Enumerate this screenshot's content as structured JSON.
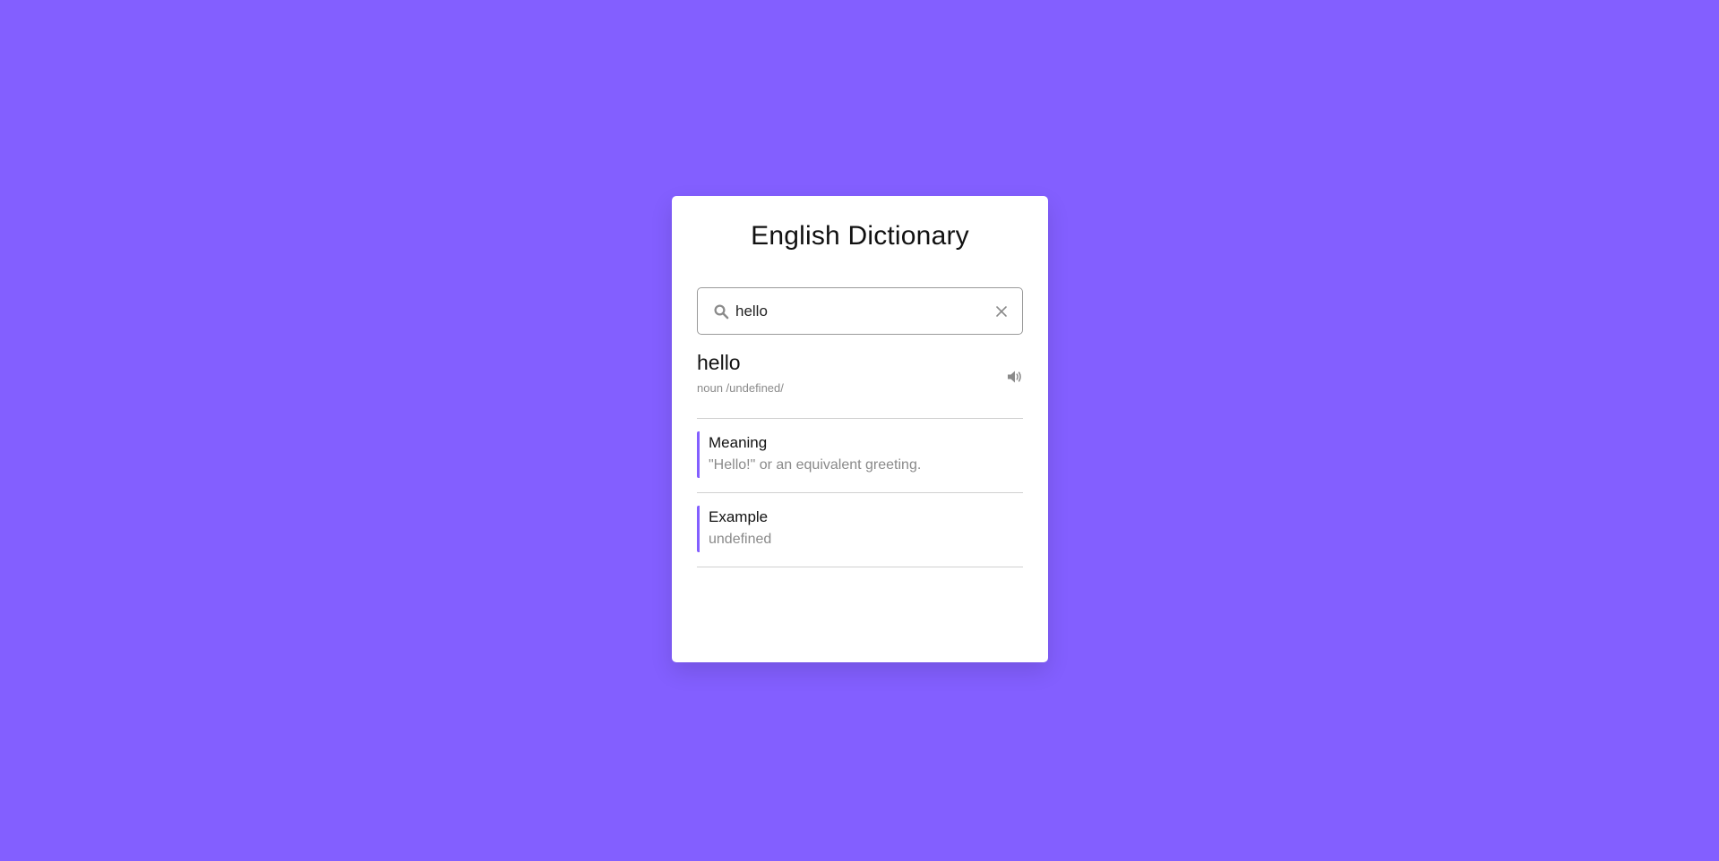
{
  "colors": {
    "background": "#835fff",
    "accent": "#835fff",
    "card": "#ffffff"
  },
  "app": {
    "title": "English Dictionary"
  },
  "search": {
    "value": "hello",
    "icon": "search-icon",
    "clear_icon": "close-icon"
  },
  "result": {
    "word": "hello",
    "phonetic": "noun /undefined/",
    "audio_icon": "volume-icon"
  },
  "details": {
    "meaning_label": "Meaning",
    "meaning_value": "\"Hello!\" or an equivalent greeting.",
    "example_label": "Example",
    "example_value": "undefined"
  }
}
